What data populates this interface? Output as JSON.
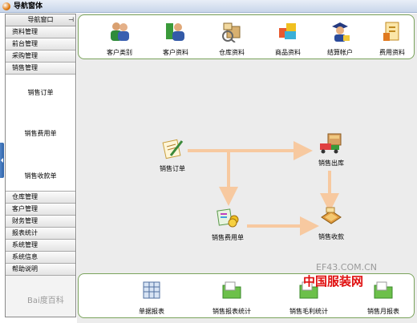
{
  "window": {
    "title": "导航窗体"
  },
  "sidebar": {
    "header": "导航窗口",
    "pin_glyph": "⊣",
    "items_top": [
      "资料管理",
      "前台管理",
      "采购管理",
      "销售管理"
    ],
    "sub_items": [
      "销售订单",
      "销售费用单",
      "销售收款单"
    ],
    "items_bottom": [
      "仓库管理",
      "客户管理",
      "财务管理",
      "报表统计",
      "系统管理",
      "系统信息",
      "帮助说明"
    ]
  },
  "toolbar": {
    "items": [
      {
        "label": "客户类别",
        "icon": "customer-category-icon"
      },
      {
        "label": "客户资料",
        "icon": "customer-profile-icon"
      },
      {
        "label": "仓库资料",
        "icon": "warehouse-icon"
      },
      {
        "label": "商品资料",
        "icon": "product-icon"
      },
      {
        "label": "结算帐户",
        "icon": "settlement-account-icon"
      },
      {
        "label": "费用资料",
        "icon": "expense-icon"
      }
    ]
  },
  "flow": {
    "order": "销售订单",
    "outbound": "销售出库",
    "expense": "销售费用单",
    "receipt": "销售收款"
  },
  "reports": {
    "items": [
      {
        "label": "单据报表",
        "icon": "document-report-icon"
      },
      {
        "label": "销售报表统计",
        "icon": "sales-report-icon"
      },
      {
        "label": "销售毛利统计",
        "icon": "gross-profit-icon"
      },
      {
        "label": "销售月报表",
        "icon": "monthly-report-icon"
      }
    ]
  },
  "watermarks": {
    "site": "EF43.COM.CN",
    "brand": "中国服装网",
    "baidu": "Bai度百科"
  },
  "colors": {
    "frame_border": "#7aa35c",
    "flow_arrow": "#f7c9a0",
    "titlebar": "#c9d6ea"
  }
}
